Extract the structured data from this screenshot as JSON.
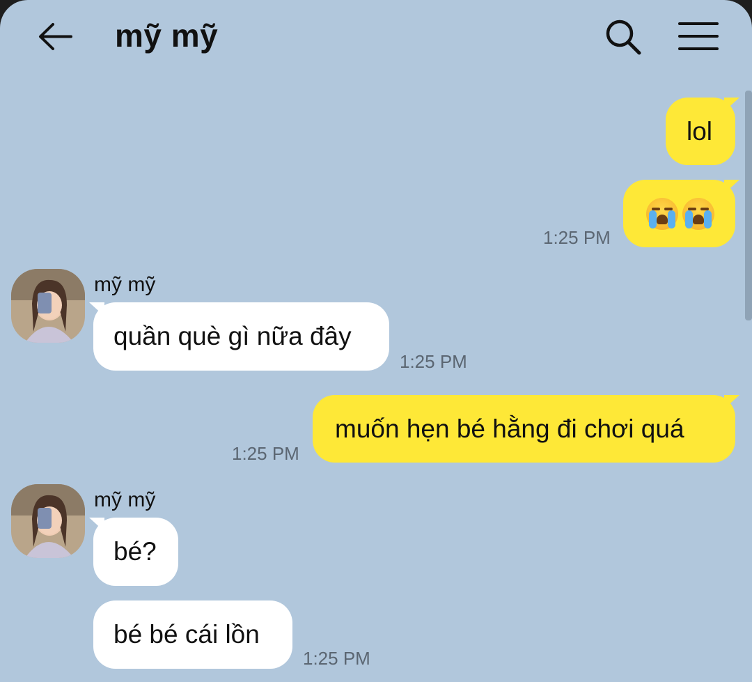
{
  "header": {
    "title": "mỹ mỹ",
    "icons": {
      "back": "arrow-left",
      "search": "magnifier",
      "menu": "hamburger"
    }
  },
  "colors": {
    "background": "#b1c7dc",
    "outgoing_bubble": "#fee837",
    "incoming_bubble": "#ffffff"
  },
  "messages": [
    {
      "direction": "out",
      "text": "lol",
      "time": ""
    },
    {
      "direction": "out",
      "text": "😭😭",
      "time": "1:25 PM",
      "emoji_count": 2,
      "emoji": "loudly-crying-face"
    },
    {
      "direction": "in",
      "sender": "mỹ mỹ",
      "text": "quần què gì nữa đây",
      "time": "1:25 PM"
    },
    {
      "direction": "out",
      "text": "muốn hẹn bé hằng đi chơi quá",
      "time": "1:25 PM"
    },
    {
      "direction": "in",
      "sender": "mỹ mỹ",
      "text": "bé?",
      "time": ""
    },
    {
      "direction": "in",
      "text": "bé bé cái lồn",
      "time": "1:25 PM"
    }
  ]
}
